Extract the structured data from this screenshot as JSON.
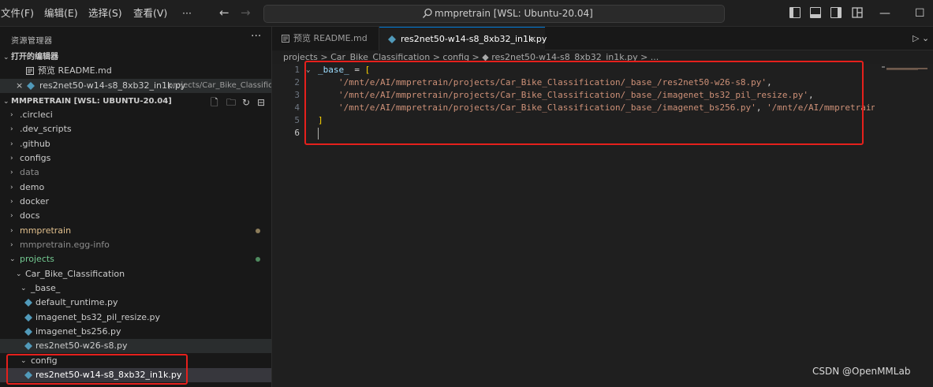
{
  "menu": {
    "file": "文件(F)",
    "edit": "编辑(E)",
    "selection": "选择(S)",
    "view": "查看(V)",
    "more": "···"
  },
  "command_center": {
    "text": "mmpretrain [WSL: Ubuntu-20.04]"
  },
  "window_controls": {
    "minimize": "—",
    "maximize": "☐"
  },
  "explorer": {
    "title": "资源管理器",
    "more": "···",
    "open_editors_title": "打开的编辑器",
    "open_editors": [
      {
        "label": "预览 README.md"
      },
      {
        "label": "res2net50-w14-s8_8xb32_in1k.py",
        "path": "projects/Car_Bike_Classificati..."
      }
    ],
    "workspace_title": "MMPRETRAIN [WSL: UBUNTU-20.04]",
    "tree": [
      {
        "label": ".circleci"
      },
      {
        "label": ".dev_scripts"
      },
      {
        "label": ".github"
      },
      {
        "label": "configs"
      },
      {
        "label": "data"
      },
      {
        "label": "demo"
      },
      {
        "label": "docker"
      },
      {
        "label": "docs"
      },
      {
        "label": "mmpretrain"
      },
      {
        "label": "mmpretrain.egg-info"
      },
      {
        "label": "projects"
      },
      {
        "label": "Car_Bike_Classification"
      },
      {
        "label": "_base_"
      },
      {
        "label": "default_runtime.py"
      },
      {
        "label": "imagenet_bs32_pil_resize.py"
      },
      {
        "label": "imagenet_bs256.py"
      },
      {
        "label": "res2net50-w26-s8.py"
      },
      {
        "label": "config"
      },
      {
        "label": "res2net50-w14-s8_8xb32_in1k.py"
      }
    ]
  },
  "tabs": [
    {
      "label": "预览 README.md"
    },
    {
      "label": "res2net50-w14-s8_8xb32_in1k.py",
      "close": "×"
    }
  ],
  "breadcrumb": "projects > Car_Bike_Classification > config > ◆ res2net50-w14-s8_8xb32_in1k.py > ...",
  "code": {
    "line_numbers": [
      "1",
      "2",
      "3",
      "4",
      "5",
      "6"
    ],
    "line1_var": "_base_",
    "line1_op": " = ",
    "line1_br": "[",
    "line2": "'/mnt/e/AI/mmpretrain/projects/Car_Bike_Classification/_base_/res2net50-w26-s8.py'",
    "line2_tail": ",",
    "line3": "'/mnt/e/AI/mmpretrain/projects/Car_Bike_Classification/_base_/imagenet_bs32_pil_resize.py'",
    "line3_tail": ",",
    "line4a": "'/mnt/e/AI/mmpretrain/projects/Car_Bike_Classification/_base_/imagenet_bs256.py'",
    "line4_sep": ", ",
    "line4b": "'/mnt/e/AI/mmpretrain/pr",
    "line5": "]"
  },
  "colors": {
    "accent": "#0078d4",
    "annotation": "#e5201c",
    "python_icon": "#519aba",
    "modified_dot": "#73c991",
    "folder_modified": "#e2c08d"
  },
  "watermark": "CSDN @OpenMMLab"
}
